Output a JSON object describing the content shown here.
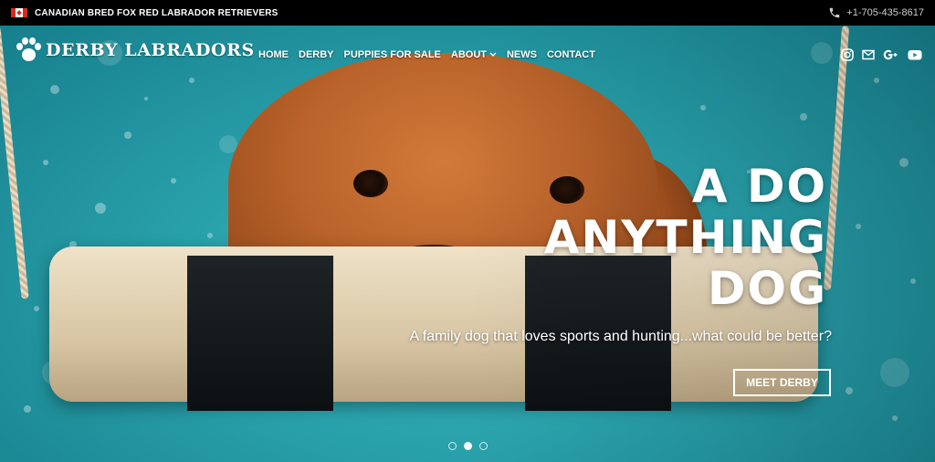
{
  "topbar": {
    "flag_icon": "canada-flag-icon",
    "tagline": "CANADIAN BRED FOX RED LABRADOR RETRIEVERS",
    "phone_icon": "phone-icon",
    "phone": "+1-705-435-8617"
  },
  "brand": {
    "logo_icon": "paw-print-icon",
    "name": "DERBY LABRADORS"
  },
  "nav": {
    "home": "HOME",
    "derby": "DERBY",
    "puppies": "PUPPIES FOR SALE",
    "about": "ABOUT",
    "news": "NEWS",
    "contact": "CONTACT"
  },
  "socials": [
    "instagram-icon",
    "mail-icon",
    "google-plus-icon",
    "youtube-icon"
  ],
  "hero": {
    "headline_line1": "A DO",
    "headline_line2": "ANYTHING",
    "headline_line3": "DOG",
    "subline": "A family dog that loves sports and hunting...what could be better?",
    "cta": "MEET DERBY",
    "slides_total": 3,
    "active_slide": 2
  }
}
